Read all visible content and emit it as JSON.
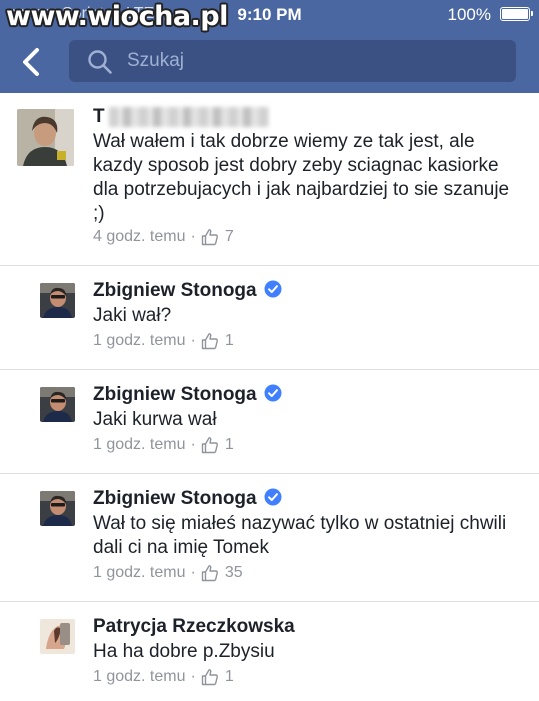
{
  "status_bar": {
    "carrier": "Spriat",
    "network": "LTE",
    "time": "9:10 PM",
    "battery": "100%"
  },
  "watermark": "www.wiocha.pl",
  "search": {
    "placeholder": "Szukaj"
  },
  "comments": [
    {
      "author_initial": "T",
      "text": "Wał wałem i tak dobrze wiemy ze tak jest, ale kazdy sposob jest dobry zeby sciagnac kasiorke dla potrzebujacych i jak najbardziej to sie szanuje ;)",
      "time": "4 godz. temu",
      "likes": "7"
    },
    {
      "author": "Zbigniew Stonoga",
      "verified": true,
      "text": "Jaki wał?",
      "time": "1 godz. temu",
      "likes": "1"
    },
    {
      "author": "Zbigniew Stonoga",
      "verified": true,
      "text": "Jaki kurwa wał",
      "time": "1 godz. temu",
      "likes": "1"
    },
    {
      "author": "Zbigniew Stonoga",
      "verified": true,
      "text": "Wał to się miałeś nazywać tylko w ostatniej chwili dali ci na imię Tomek",
      "time": "1 godz. temu",
      "likes": "35"
    },
    {
      "author": "Patrycja Rzeczkowska",
      "verified": false,
      "text": "Ha ha dobre p.Zbysiu",
      "time": "1 godz. temu",
      "likes": "1"
    }
  ],
  "colors": {
    "header": "#4b67a1",
    "search_bg": "#3b5184",
    "verified": "#4080ff",
    "meta_gray": "#90949c"
  },
  "icons": [
    "back-chevron-icon",
    "search-icon",
    "verified-badge-icon",
    "thumbs-up-icon",
    "wifi-icon",
    "battery-icon"
  ]
}
